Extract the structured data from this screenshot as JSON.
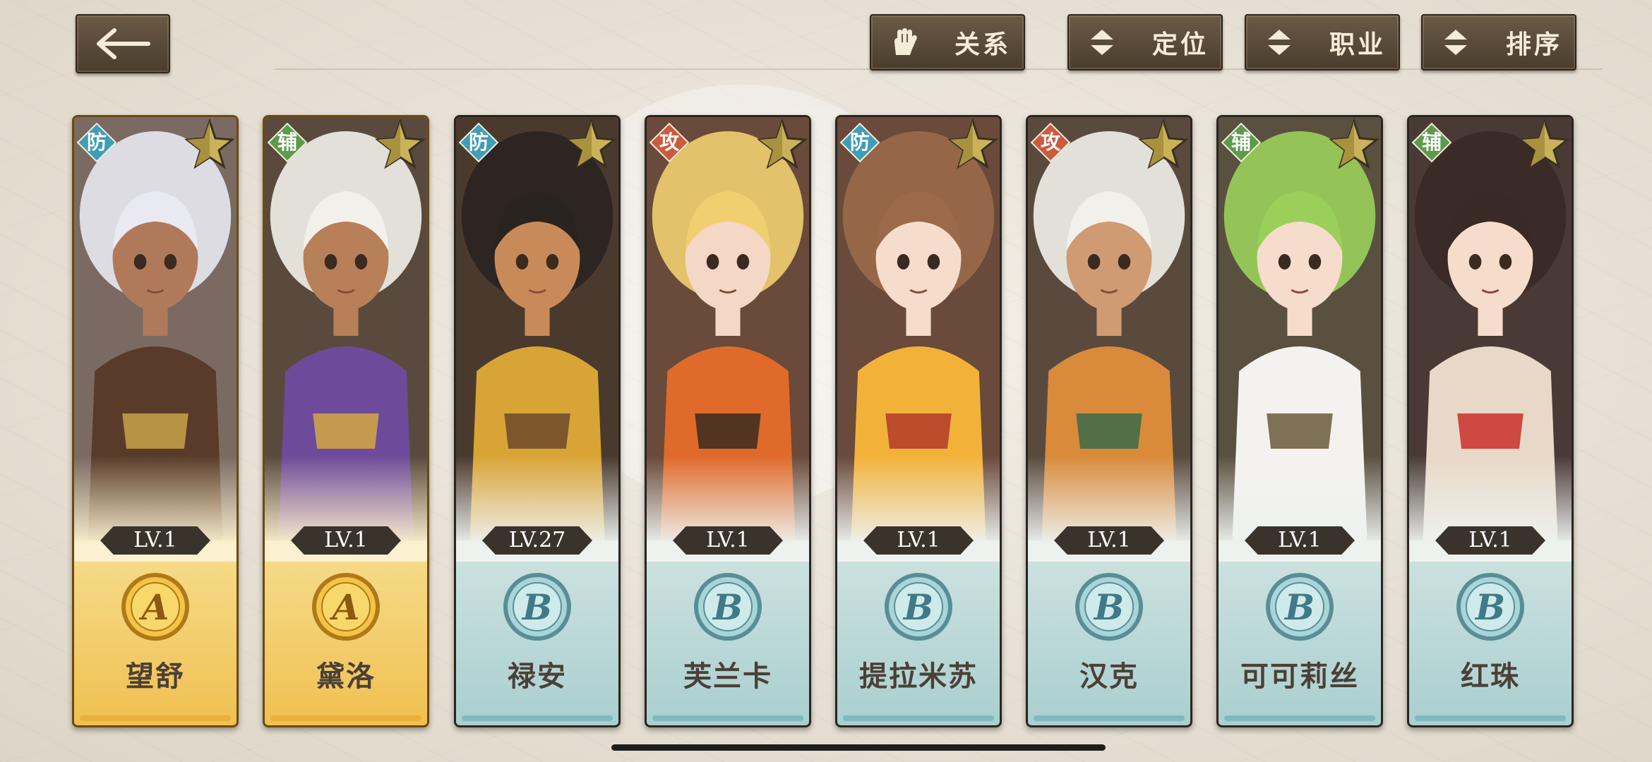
{
  "toolbar": {
    "back_icon": "arrow-left-icon",
    "buttons": [
      {
        "label": "关系",
        "icon": "glove-icon"
      },
      {
        "label": "定位",
        "icon": "sort-updown-icon"
      },
      {
        "label": "职业",
        "icon": "sort-updown-icon"
      },
      {
        "label": "排序",
        "icon": "sort-updown-icon"
      }
    ]
  },
  "colors": {
    "role_defense": "#3f9db6",
    "role_support": "#5d9a4c",
    "role_attack": "#cc5a3e",
    "rank_a_gold": "#e9b13a",
    "rank_b_teal": "#7fbac0"
  },
  "characters": [
    {
      "name": "望舒",
      "level": "LV.1",
      "role": "防",
      "rank": "A"
    },
    {
      "name": "黛洛",
      "level": "LV.1",
      "role": "辅",
      "rank": "A"
    },
    {
      "name": "禄安",
      "level": "LV.27",
      "role": "防",
      "rank": "B"
    },
    {
      "name": "芙兰卡",
      "level": "LV.1",
      "role": "攻",
      "rank": "B"
    },
    {
      "name": "提拉米苏",
      "level": "LV.1",
      "role": "防",
      "rank": "B"
    },
    {
      "name": "汉克",
      "level": "LV.1",
      "role": "攻",
      "rank": "B"
    },
    {
      "name": "可可莉丝",
      "level": "LV.1",
      "role": "辅",
      "rank": "B"
    },
    {
      "name": "红珠",
      "level": "LV.1",
      "role": "辅",
      "rank": "B"
    }
  ]
}
